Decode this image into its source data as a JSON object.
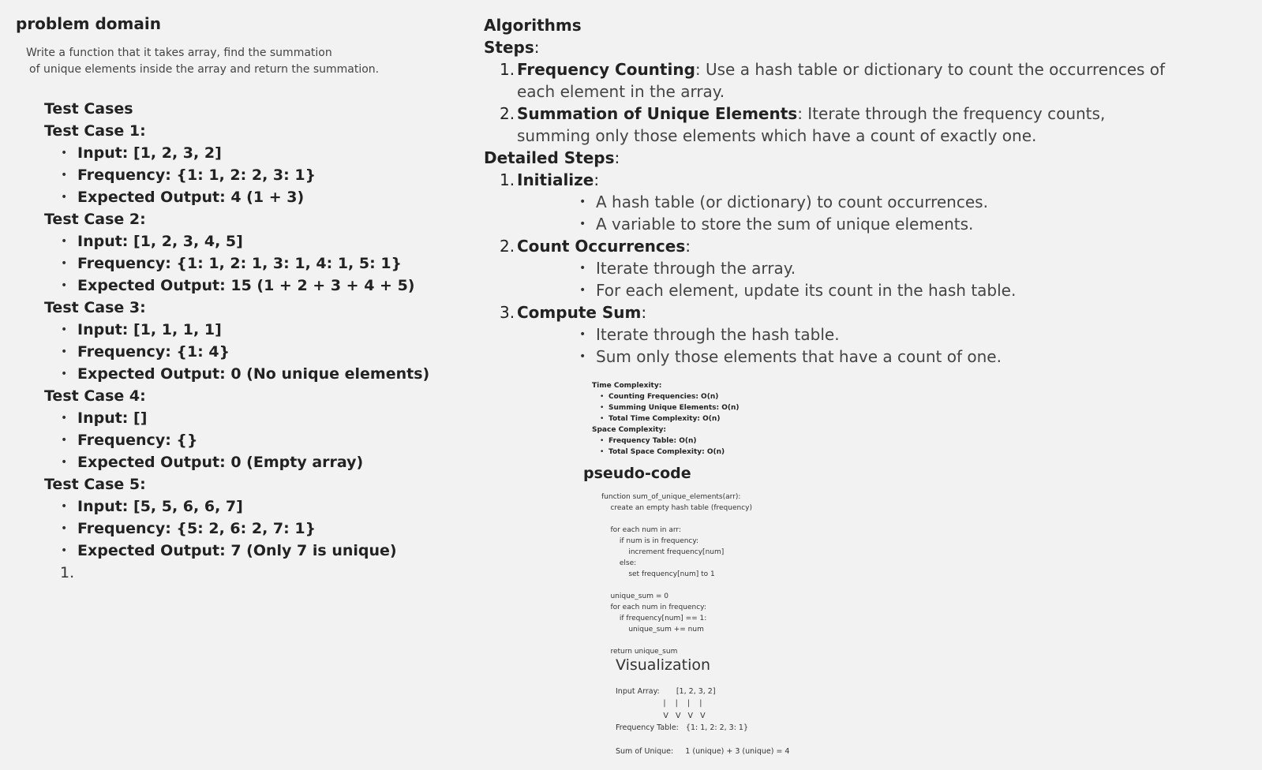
{
  "problem": {
    "title": "problem domain",
    "description_line1": "Write a function that it takes array, find the summation",
    "description_line2": "of unique elements inside the array and return the summation."
  },
  "tests": {
    "heading": "Test Cases",
    "cases": [
      {
        "title": "Test Case 1:",
        "input": "Input: [1, 2, 3, 2]",
        "frequency": "Frequency: {1: 1, 2: 2, 3: 1}",
        "expected": "Expected Output: 4 (1 + 3)"
      },
      {
        "title": "Test Case 2:",
        "input": "Input: [1, 2, 3, 4, 5]",
        "frequency": "Frequency: {1: 1, 2: 1, 3: 1, 4: 1, 5: 1}",
        "expected": "Expected Output: 15 (1 + 2 + 3 + 4 + 5)"
      },
      {
        "title": "Test Case 3:",
        "input": "Input: [1, 1, 1, 1]",
        "frequency": "Frequency: {1: 4}",
        "expected": "Expected Output: 0 (No unique elements)"
      },
      {
        "title": "Test Case 4:",
        "input": "Input: []",
        "frequency": "Frequency: {}",
        "expected": "Expected Output: 0 (Empty array)"
      },
      {
        "title": "Test Case 5:",
        "input": "Input: [5, 5, 6, 6, 7]",
        "frequency": "Frequency: {5: 2, 6: 2, 7: 1}",
        "expected": "Expected Output: 7 (Only 7 is unique)"
      }
    ],
    "stray_item": "1."
  },
  "algorithms": {
    "title": "Algorithms",
    "steps_label": "Steps",
    "steps": [
      {
        "num": "1.",
        "bold": "Frequency Counting",
        "text": ": Use a hash table or dictionary to count the occurrences of each element in the array."
      },
      {
        "num": "2.",
        "bold": "Summation of Unique Elements",
        "text": ": Iterate through the frequency counts, summing only those elements which have a count of exactly one."
      }
    ],
    "detailed_label": "Detailed Steps",
    "detailed": [
      {
        "num": "1.",
        "bold": "Initialize",
        "items": [
          "A hash table (or dictionary) to count occurrences.",
          "A variable to store the sum of unique elements."
        ]
      },
      {
        "num": "2.",
        "bold": "Count Occurrences",
        "items": [
          "Iterate through the array.",
          "For each element, update its count in the hash table."
        ]
      },
      {
        "num": "3.",
        "bold": "Compute Sum",
        "items": [
          "Iterate through the hash table.",
          "Sum only those elements that have a count of one."
        ]
      }
    ]
  },
  "complexity": {
    "time_label": "Time Complexity:",
    "time_items": [
      "Counting Frequencies: O(n)",
      "Summing Unique Elements: O(n)",
      "Total Time Complexity: O(n)"
    ],
    "space_label": "Space Complexity:",
    "space_items": [
      "Frequency Table: O(n)",
      "Total Space Complexity: O(n)"
    ]
  },
  "pseudocode": {
    "title": "pseudo-code",
    "code": "function sum_of_unique_elements(arr):\n    create an empty hash table (frequency)\n\n    for each num in arr:\n        if num is in frequency:\n            increment frequency[num]\n        else:\n            set frequency[num] to 1\n\n    unique_sum = 0\n    for each num in frequency:\n        if frequency[num] == 1:\n            unique_sum += num\n\n    return unique_sum"
  },
  "visualization": {
    "title": "Visualization",
    "text": "Input Array:       [1, 2, 3, 2]\n                    |    |    |    |\n                    V   V   V   V\nFrequency Table:   {1: 1, 2: 2, 3: 1}\n\nSum of Unique:     1 (unique) + 3 (unique) = 4"
  }
}
